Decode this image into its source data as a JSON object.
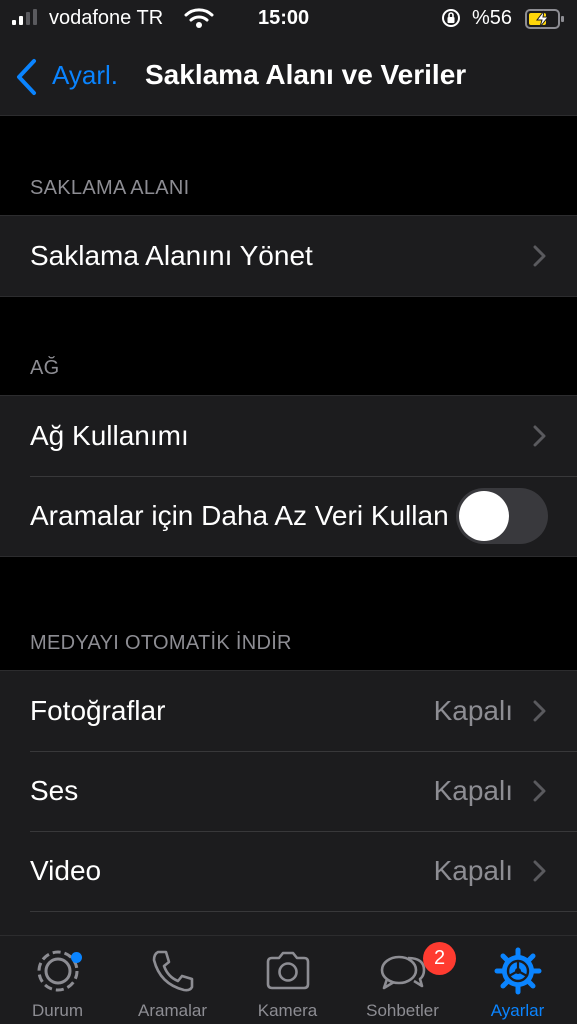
{
  "status_bar": {
    "carrier": "vodafone TR",
    "time": "15:00",
    "battery": "%56"
  },
  "nav": {
    "back_label": "Ayarl.",
    "title": "Saklama Alanı ve Veriler"
  },
  "sections": {
    "storage": {
      "header": "SAKLAMA ALANI",
      "rows": [
        {
          "label": "Saklama Alanını Yönet"
        }
      ]
    },
    "network": {
      "header": "AĞ",
      "rows": [
        {
          "label": "Ağ Kullanımı"
        },
        {
          "label": "Aramalar için Daha Az Veri Kullan",
          "toggle_on": false
        }
      ]
    },
    "auto_download": {
      "header": "MEDYAYI OTOMATİK İNDİR",
      "rows": [
        {
          "label": "Fotoğraflar",
          "value": "Kapalı"
        },
        {
          "label": "Ses",
          "value": "Kapalı"
        },
        {
          "label": "Video",
          "value": "Kapalı"
        }
      ]
    }
  },
  "tabs": [
    {
      "label": "Durum",
      "icon": "status-icon"
    },
    {
      "label": "Aramalar",
      "icon": "phone-icon"
    },
    {
      "label": "Kamera",
      "icon": "camera-icon"
    },
    {
      "label": "Sohbetler",
      "icon": "chats-icon",
      "badge": "2"
    },
    {
      "label": "Ayarlar",
      "icon": "settings-gear-icon",
      "active": true
    }
  ],
  "colors": {
    "accent": "#0a84ff",
    "badge": "#ff3b30",
    "battery_charge": "#ffd60a"
  }
}
